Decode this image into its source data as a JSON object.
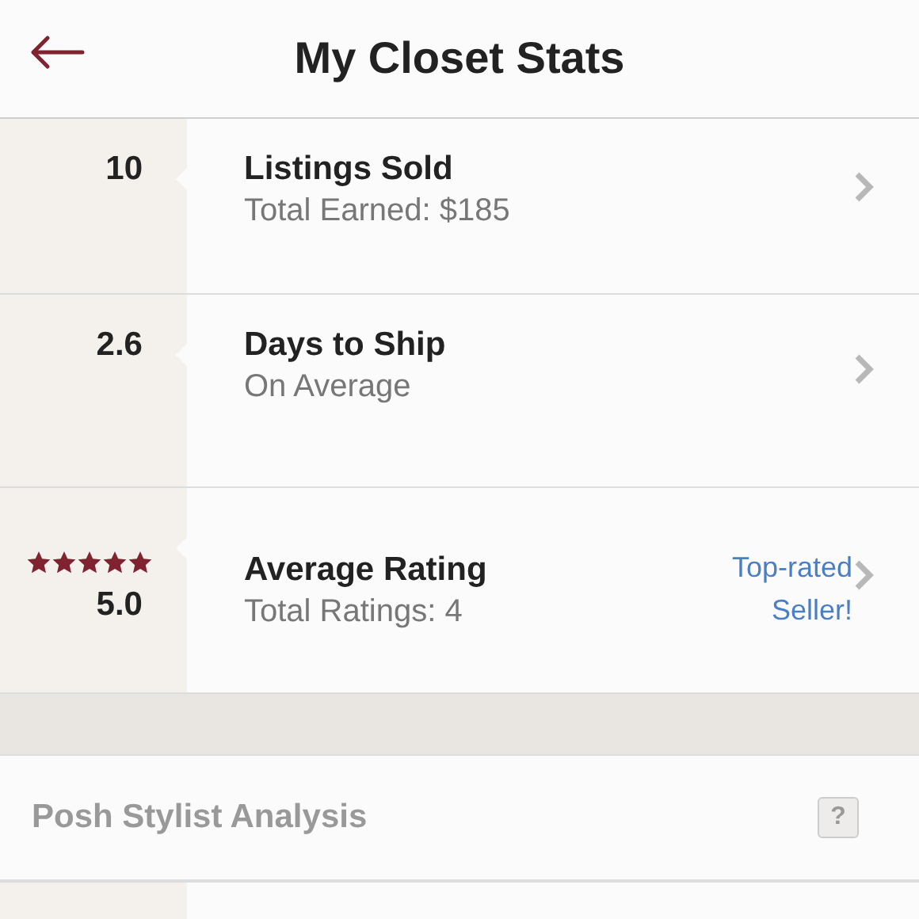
{
  "header": {
    "title": "My Closet Stats"
  },
  "stats": [
    {
      "kind": "plain",
      "value": "10",
      "title": "Listings Sold",
      "subtitle": "Total Earned: $185"
    },
    {
      "kind": "plain",
      "value": "2.6",
      "title": "Days to Ship",
      "subtitle": "On Average"
    },
    {
      "kind": "rating",
      "stars": 5,
      "value": "5.0",
      "title": "Average Rating",
      "subtitle": "Total Ratings: 4",
      "badge_lines": [
        "Top-rated",
        "Seller!"
      ]
    }
  ],
  "section": {
    "title": "Posh Stylist Analysis",
    "help": "?"
  }
}
